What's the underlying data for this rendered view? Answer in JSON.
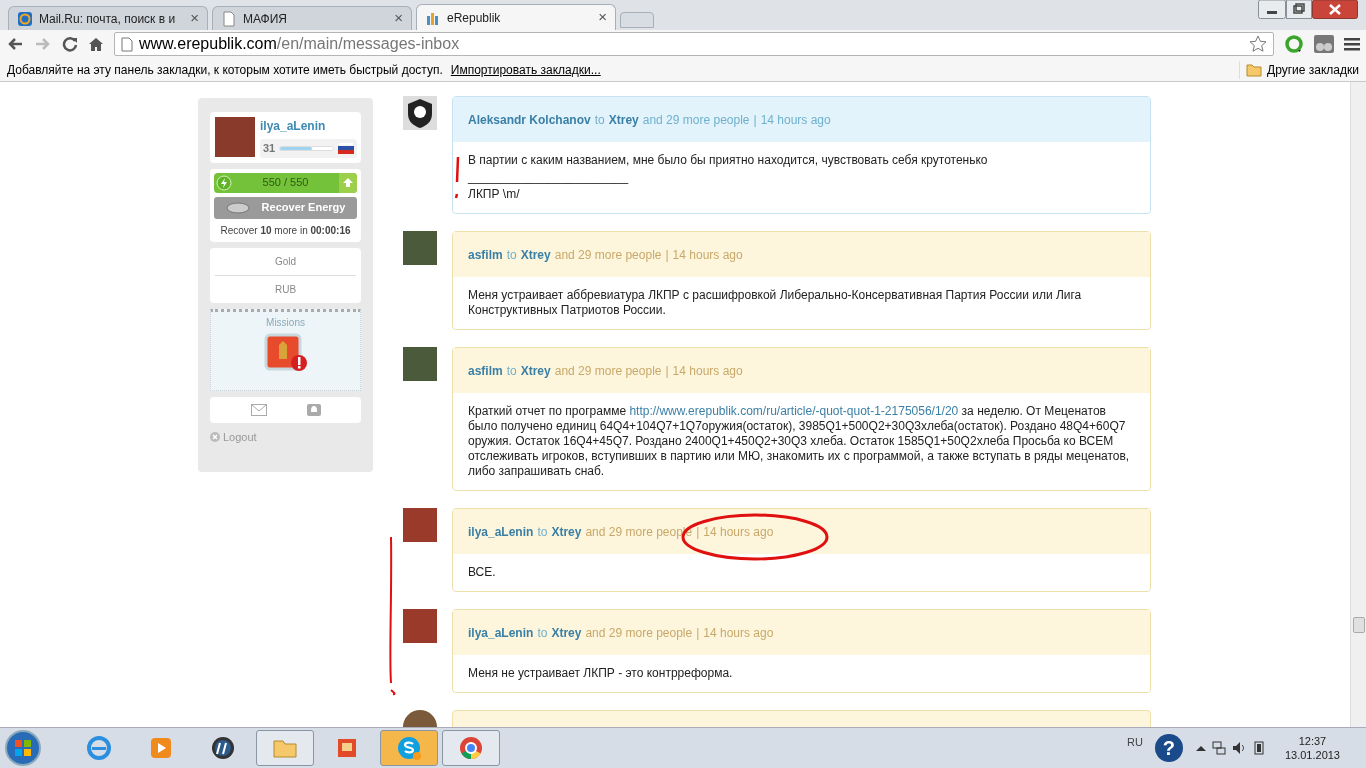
{
  "browser": {
    "tabs": [
      {
        "kind": "mail",
        "title": "Mail.Ru: почта, поиск в и",
        "selected": false
      },
      {
        "kind": "page",
        "title": "МАФИЯ",
        "selected": false
      },
      {
        "kind": "site",
        "title": "eRepublik",
        "selected": true
      }
    ],
    "close_glyph": "×",
    "address": {
      "host": "www.erepublik.com",
      "path": "/en/main/messages-inbox"
    },
    "bookmarks_hint": "Добавляйте на эту панель закладки, к которым хотите иметь быстрый доступ.",
    "import_link": "Импортировать закладки...",
    "other_bookmarks": "Другие закладки"
  },
  "sidebar": {
    "username": "ilya_aLenin",
    "level_number": "31",
    "xp": {
      "level": 0.6
    },
    "energy": {
      "reading": "550 / 550",
      "level": 1.0
    },
    "recover_button": "Recover Energy",
    "recover_note": "Recover **10** more in **00:00:16**",
    "currencies": [
      "Gold",
      "RUB"
    ],
    "missions": "Missions",
    "logout": "Logout"
  },
  "messages": [
    {
      "kind": "emblem",
      "highlighted": true,
      "sender": "Aleksandr Kolchanov",
      "to": "to",
      "recipient": "Xtrey",
      "others": "and 29 more people",
      "separator": "|",
      "time": "14 hours ago",
      "body": [
        [
          {
            "kind": "text",
            "text": "В партии с каким названием, мне было бы приятно находится, чувствовать себя крутотенько"
          }
        ],
        [
          {
            "kind": "text",
            "text": "________________________"
          }
        ],
        [
          {
            "kind": "text",
            "text": "ЛКПР \\m/"
          }
        ]
      ]
    },
    {
      "kind": "photo",
      "highlighted": false,
      "sender": "asfilm",
      "to": "to",
      "recipient": "Xtrey",
      "others": "and 29 more people",
      "separator": "|",
      "time": "14 hours ago",
      "body": [
        [
          {
            "kind": "text",
            "text": "Меня устраивает аббревиатура ЛКПР с расшифровкой Либерально-Консервативная Партия России или Лига Конструктивных Патриотов России."
          }
        ]
      ]
    },
    {
      "kind": "photo",
      "highlighted": false,
      "sender": "asfilm",
      "to": "to",
      "recipient": "Xtrey",
      "others": "and 29 more people",
      "separator": "|",
      "time": "14 hours ago",
      "body": [
        [
          {
            "kind": "text",
            "text": "Краткий отчет по программе "
          },
          {
            "kind": "link",
            "text": "http://www.erepublik.com/ru/article/-quot-quot-1-2175056/1/20"
          },
          {
            "kind": "text",
            "text": " за неделю. От Меценатов было получено единиц 64Q4+104Q7+1Q7оружия(остаток), 3985Q1+500Q2+30Q3хлеба(остаток). Роздано 48Q4+60Q7 оружия. Остаток 16Q4+45Q7. Роздано 2400Q1+450Q2+30Q3 хлеба. Остаток 1585Q1+50Q2хлеба Просьба ко ВСЕМ отслеживать игроков, вступивших в партию или МЮ, знакомить их с программой, а также вступать в ряды меценатов, либо запрашивать снаб."
          }
        ]
      ]
    },
    {
      "kind": "hero",
      "highlighted": false,
      "sender": "ilya_aLenin",
      "to": "to",
      "recipient": "Xtrey",
      "others": "and 29 more people",
      "separator": "|",
      "time": "14 hours ago",
      "body": [
        [
          {
            "kind": "text",
            "text": "ВСЕ."
          }
        ]
      ]
    },
    {
      "kind": "hero",
      "highlighted": false,
      "sender": "ilya_aLenin",
      "to": "to",
      "recipient": "Xtrey",
      "others": "and 29 more people",
      "separator": "|",
      "time": "14 hours ago",
      "body": [
        [
          {
            "kind": "text",
            "text": "Меня не устраивает ЛКПР - это контрреформа."
          }
        ]
      ]
    }
  ],
  "taskbar": {
    "apps": [
      {
        "kind": "ie",
        "running": false,
        "active": false
      },
      {
        "kind": "media",
        "running": false,
        "active": false
      },
      {
        "kind": "hp",
        "running": false,
        "active": false
      },
      {
        "kind": "explorer",
        "running": true,
        "active": false
      },
      {
        "kind": "photos",
        "running": false,
        "active": false
      },
      {
        "kind": "skype",
        "running": true,
        "active": true
      },
      {
        "kind": "chrome",
        "running": true,
        "active": false
      }
    ],
    "language": "RU",
    "help": "?",
    "time": "12:37",
    "date": "13.01.2013"
  }
}
